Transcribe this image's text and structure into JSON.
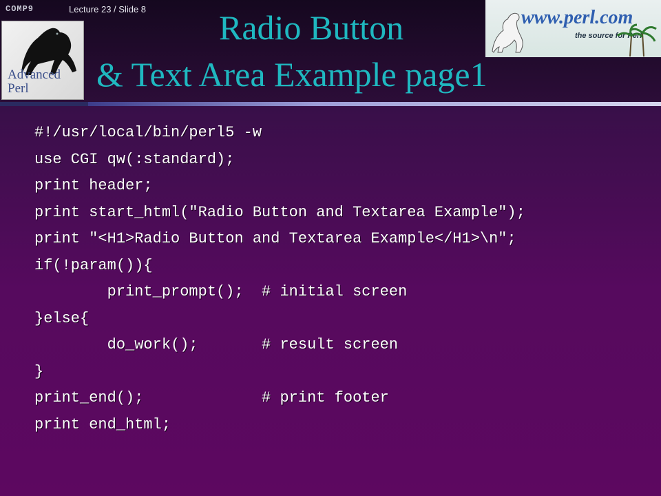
{
  "header": {
    "comp_logo_text": "COMP9",
    "slide_label": "Lecture 23 / Slide 8"
  },
  "book_cover": {
    "title_line1": "Advanced",
    "title_line2": "Perl"
  },
  "perl_banner": {
    "url": "www.perl.com",
    "tagline": "the source for Perl"
  },
  "title": {
    "line1": "Radio Button",
    "line2": "& Text Area Example page1"
  },
  "code": {
    "lines": [
      "#!/usr/local/bin/perl5 -w",
      "use CGI qw(:standard);",
      "print header;",
      "print start_html(\"Radio Button and Textarea Example\");",
      "print \"<H1>Radio Button and Textarea Example</H1>\\n\";",
      "if(!param()){",
      "        print_prompt();  # initial screen",
      "}else{",
      "        do_work();       # result screen",
      "}",
      "print_end();             # print footer",
      "print end_html;"
    ]
  },
  "colors": {
    "title": "#1fb8c0",
    "background": "#5d0860",
    "code_text": "#ffffff"
  }
}
